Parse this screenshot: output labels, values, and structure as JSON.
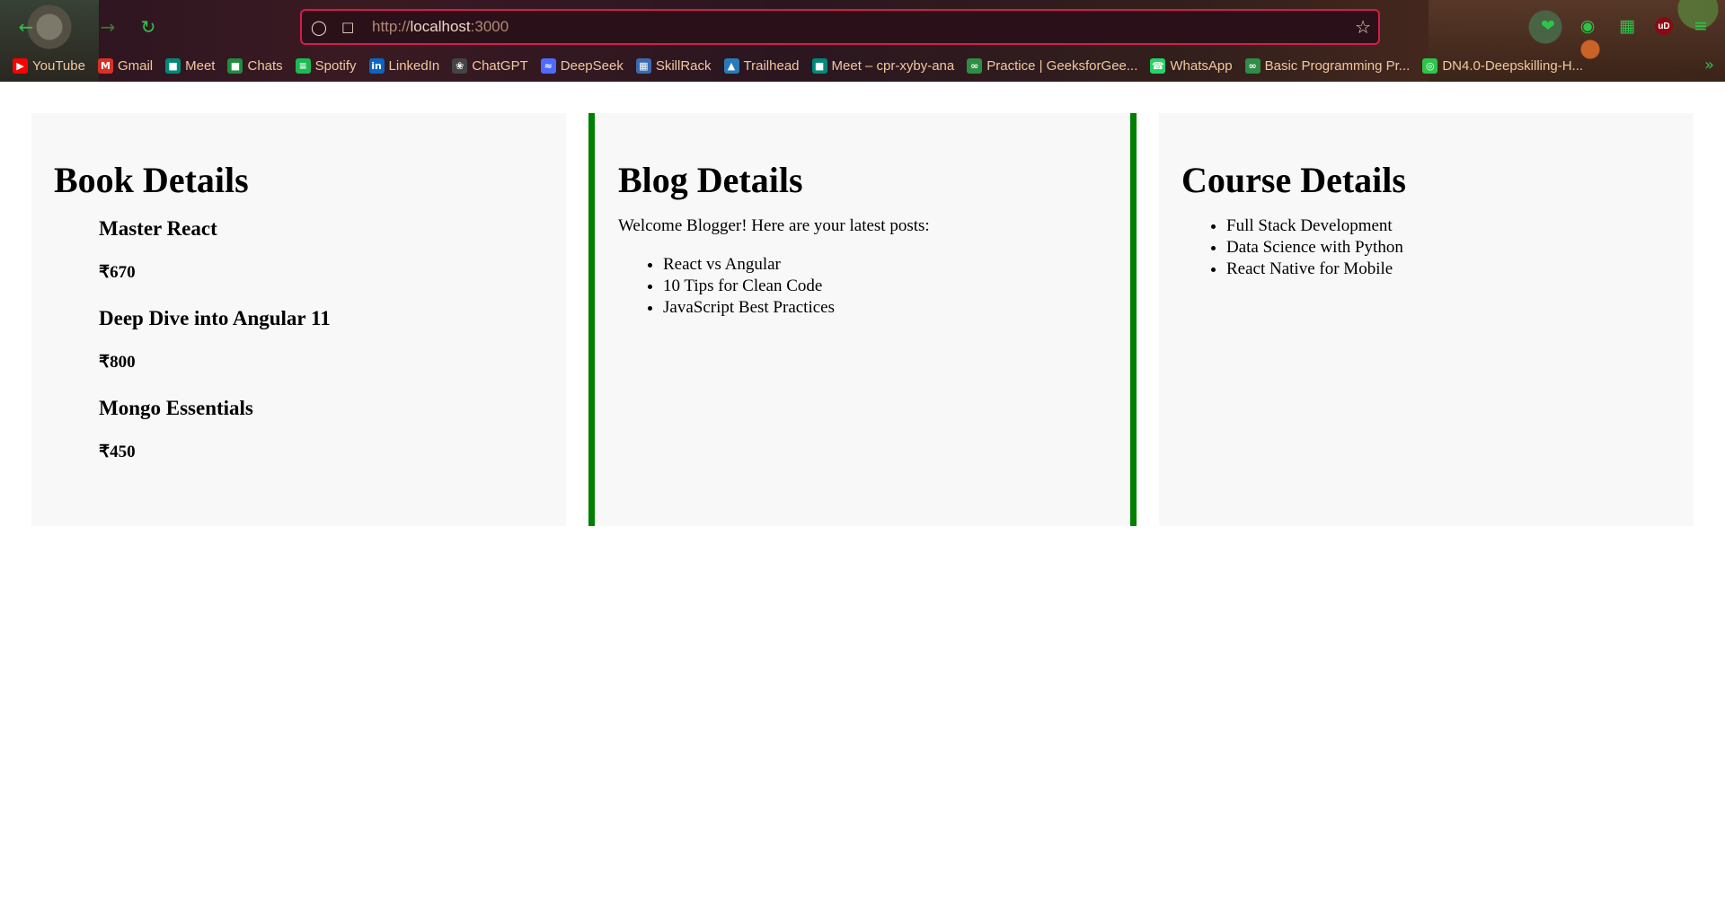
{
  "browser": {
    "url_scheme": "http://",
    "url_host": "localhost",
    "url_port": ":3000",
    "extension_badge": "uD",
    "bookmarks": [
      {
        "label": "YouTube",
        "icon": "youtube-icon",
        "color": "#ff0000"
      },
      {
        "label": "Gmail",
        "icon": "gmail-icon",
        "color": "#d93025"
      },
      {
        "label": "Meet",
        "icon": "meet-icon",
        "color": "#00897b"
      },
      {
        "label": "Chats",
        "icon": "chats-icon",
        "color": "#1e8e3e"
      },
      {
        "label": "Spotify",
        "icon": "spotify-icon",
        "color": "#1db954"
      },
      {
        "label": "LinkedIn",
        "icon": "linkedin-icon",
        "color": "#0a66c2"
      },
      {
        "label": "ChatGPT",
        "icon": "chatgpt-icon",
        "color": "#444444"
      },
      {
        "label": "DeepSeek",
        "icon": "deepseek-icon",
        "color": "#4d6bfe"
      },
      {
        "label": "SkillRack",
        "icon": "skillrack-icon",
        "color": "#3a6ab0"
      },
      {
        "label": "Trailhead",
        "icon": "trailhead-icon",
        "color": "#2a7ab8"
      },
      {
        "label": "Meet – cpr-xyby-ana",
        "icon": "meet-icon",
        "color": "#00897b"
      },
      {
        "label": "Practice | GeeksforGee...",
        "icon": "geeksforgeeks-icon",
        "color": "#2f8d46"
      },
      {
        "label": "WhatsApp",
        "icon": "whatsapp-icon",
        "color": "#25d366"
      },
      {
        "label": "Basic Programming Pr...",
        "icon": "geeksforgeeks-icon",
        "color": "#2f8d46"
      },
      {
        "label": "DN4.0-Deepskilling-H...",
        "icon": "globe-icon",
        "color": "#2ec44a"
      }
    ]
  },
  "book": {
    "heading": "Book Details",
    "items": [
      {
        "title": "Master React",
        "price": "₹670"
      },
      {
        "title": "Deep Dive into Angular 11",
        "price": "₹800"
      },
      {
        "title": "Mongo Essentials",
        "price": "₹450"
      }
    ]
  },
  "blog": {
    "heading": "Blog Details",
    "intro": "Welcome Blogger! Here are your latest posts:",
    "posts": [
      "React vs Angular",
      "10 Tips for Clean Code",
      "JavaScript Best Practices"
    ]
  },
  "course": {
    "heading": "Course Details",
    "items": [
      "Full Stack Development",
      "Data Science with Python",
      "React Native for Mobile"
    ]
  },
  "colors": {
    "accent_border": "#008000",
    "panel_bg": "#f8f8f8",
    "url_border": "#d81b4a"
  }
}
